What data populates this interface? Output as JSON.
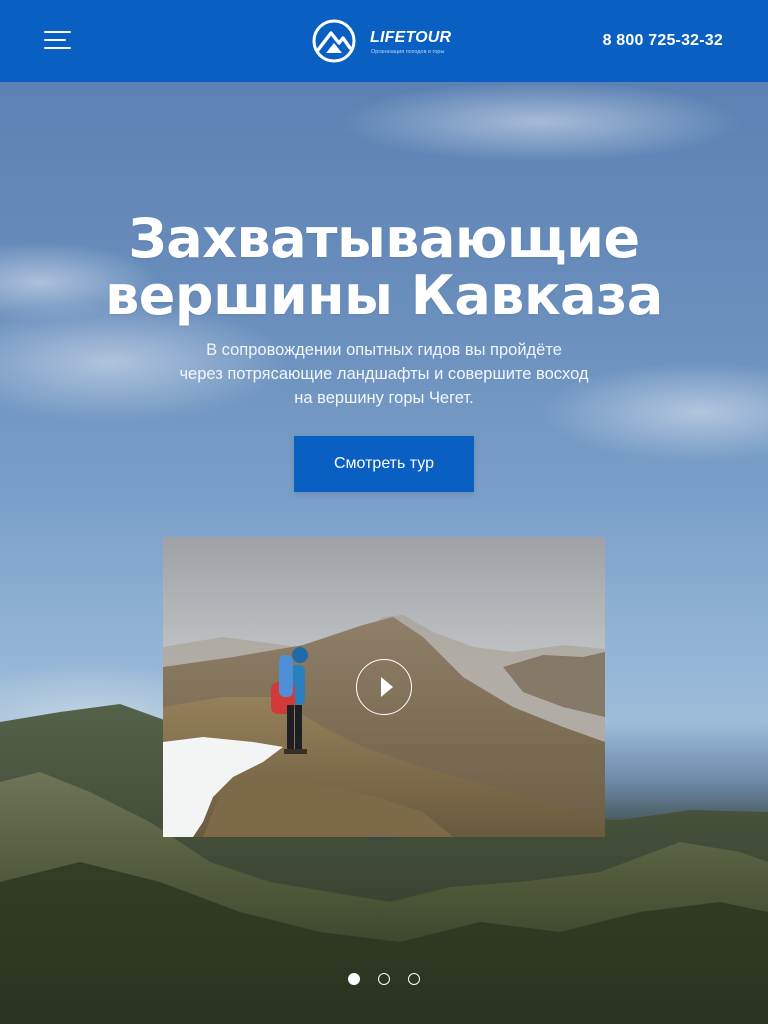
{
  "header": {
    "brand": "LIFETOUR",
    "tagline": "Организация походов в горы",
    "phone": "8 800 725-32-32",
    "menu_icon": "hamburger-icon",
    "logo_icon": "mountain-logo-icon",
    "background_color": "#0a5fc2"
  },
  "hero": {
    "title": "Захватывающие\nвершины Кавказа",
    "subtitle": "В сопровождении опытных гидов вы пройдёте\nчерез потрясающие ландшафты и совершите восход\nна вершину горы Чегет.",
    "cta_label": "Смотреть тур",
    "video": {
      "play_icon": "play-icon"
    },
    "slider": {
      "total": 3,
      "active": 1
    }
  },
  "colors": {
    "accent": "#0a5fc2",
    "text": "#ffffff"
  }
}
